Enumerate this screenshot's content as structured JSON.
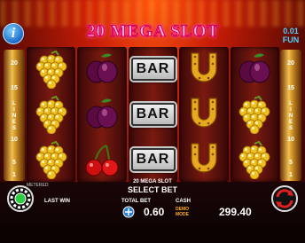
{
  "header": {
    "title": "20 MEGA SLOT",
    "info_label": "i",
    "fun_value": "0.01",
    "fun_label": "FUN"
  },
  "lines_rail": {
    "numbers": [
      "20",
      "15",
      "10",
      "5",
      "1"
    ],
    "label": "LINES"
  },
  "reels": [
    [
      "grapes",
      "grapes",
      "grapes"
    ],
    [
      "plum",
      "plum",
      "cherries"
    ],
    [
      "bar",
      "bar",
      "bar"
    ],
    [
      "horseshoe",
      "horseshoe",
      "horseshoe"
    ],
    [
      "plum",
      "grapes",
      "grapes"
    ]
  ],
  "symbols_text": {
    "bar": "BAR"
  },
  "footer": {
    "metered_label": "METERED",
    "game_name": "20 MEGA SLOT",
    "select_bet": "SELECT BET",
    "last_win_label": "LAST WIN",
    "total_bet_label": "TOTAL BET",
    "total_bet_value": "0.60",
    "cash_label": "CASH",
    "cash_value": "299.40",
    "demo_line1": "DEMO",
    "demo_line2": "MODE"
  },
  "colors": {
    "accent_pink": "#ff2a9a",
    "info_blue": "#1a68c8",
    "fun_cyan": "#4fd0ff",
    "spin_green": "#2ecc40",
    "auto_red": "#e02020"
  }
}
